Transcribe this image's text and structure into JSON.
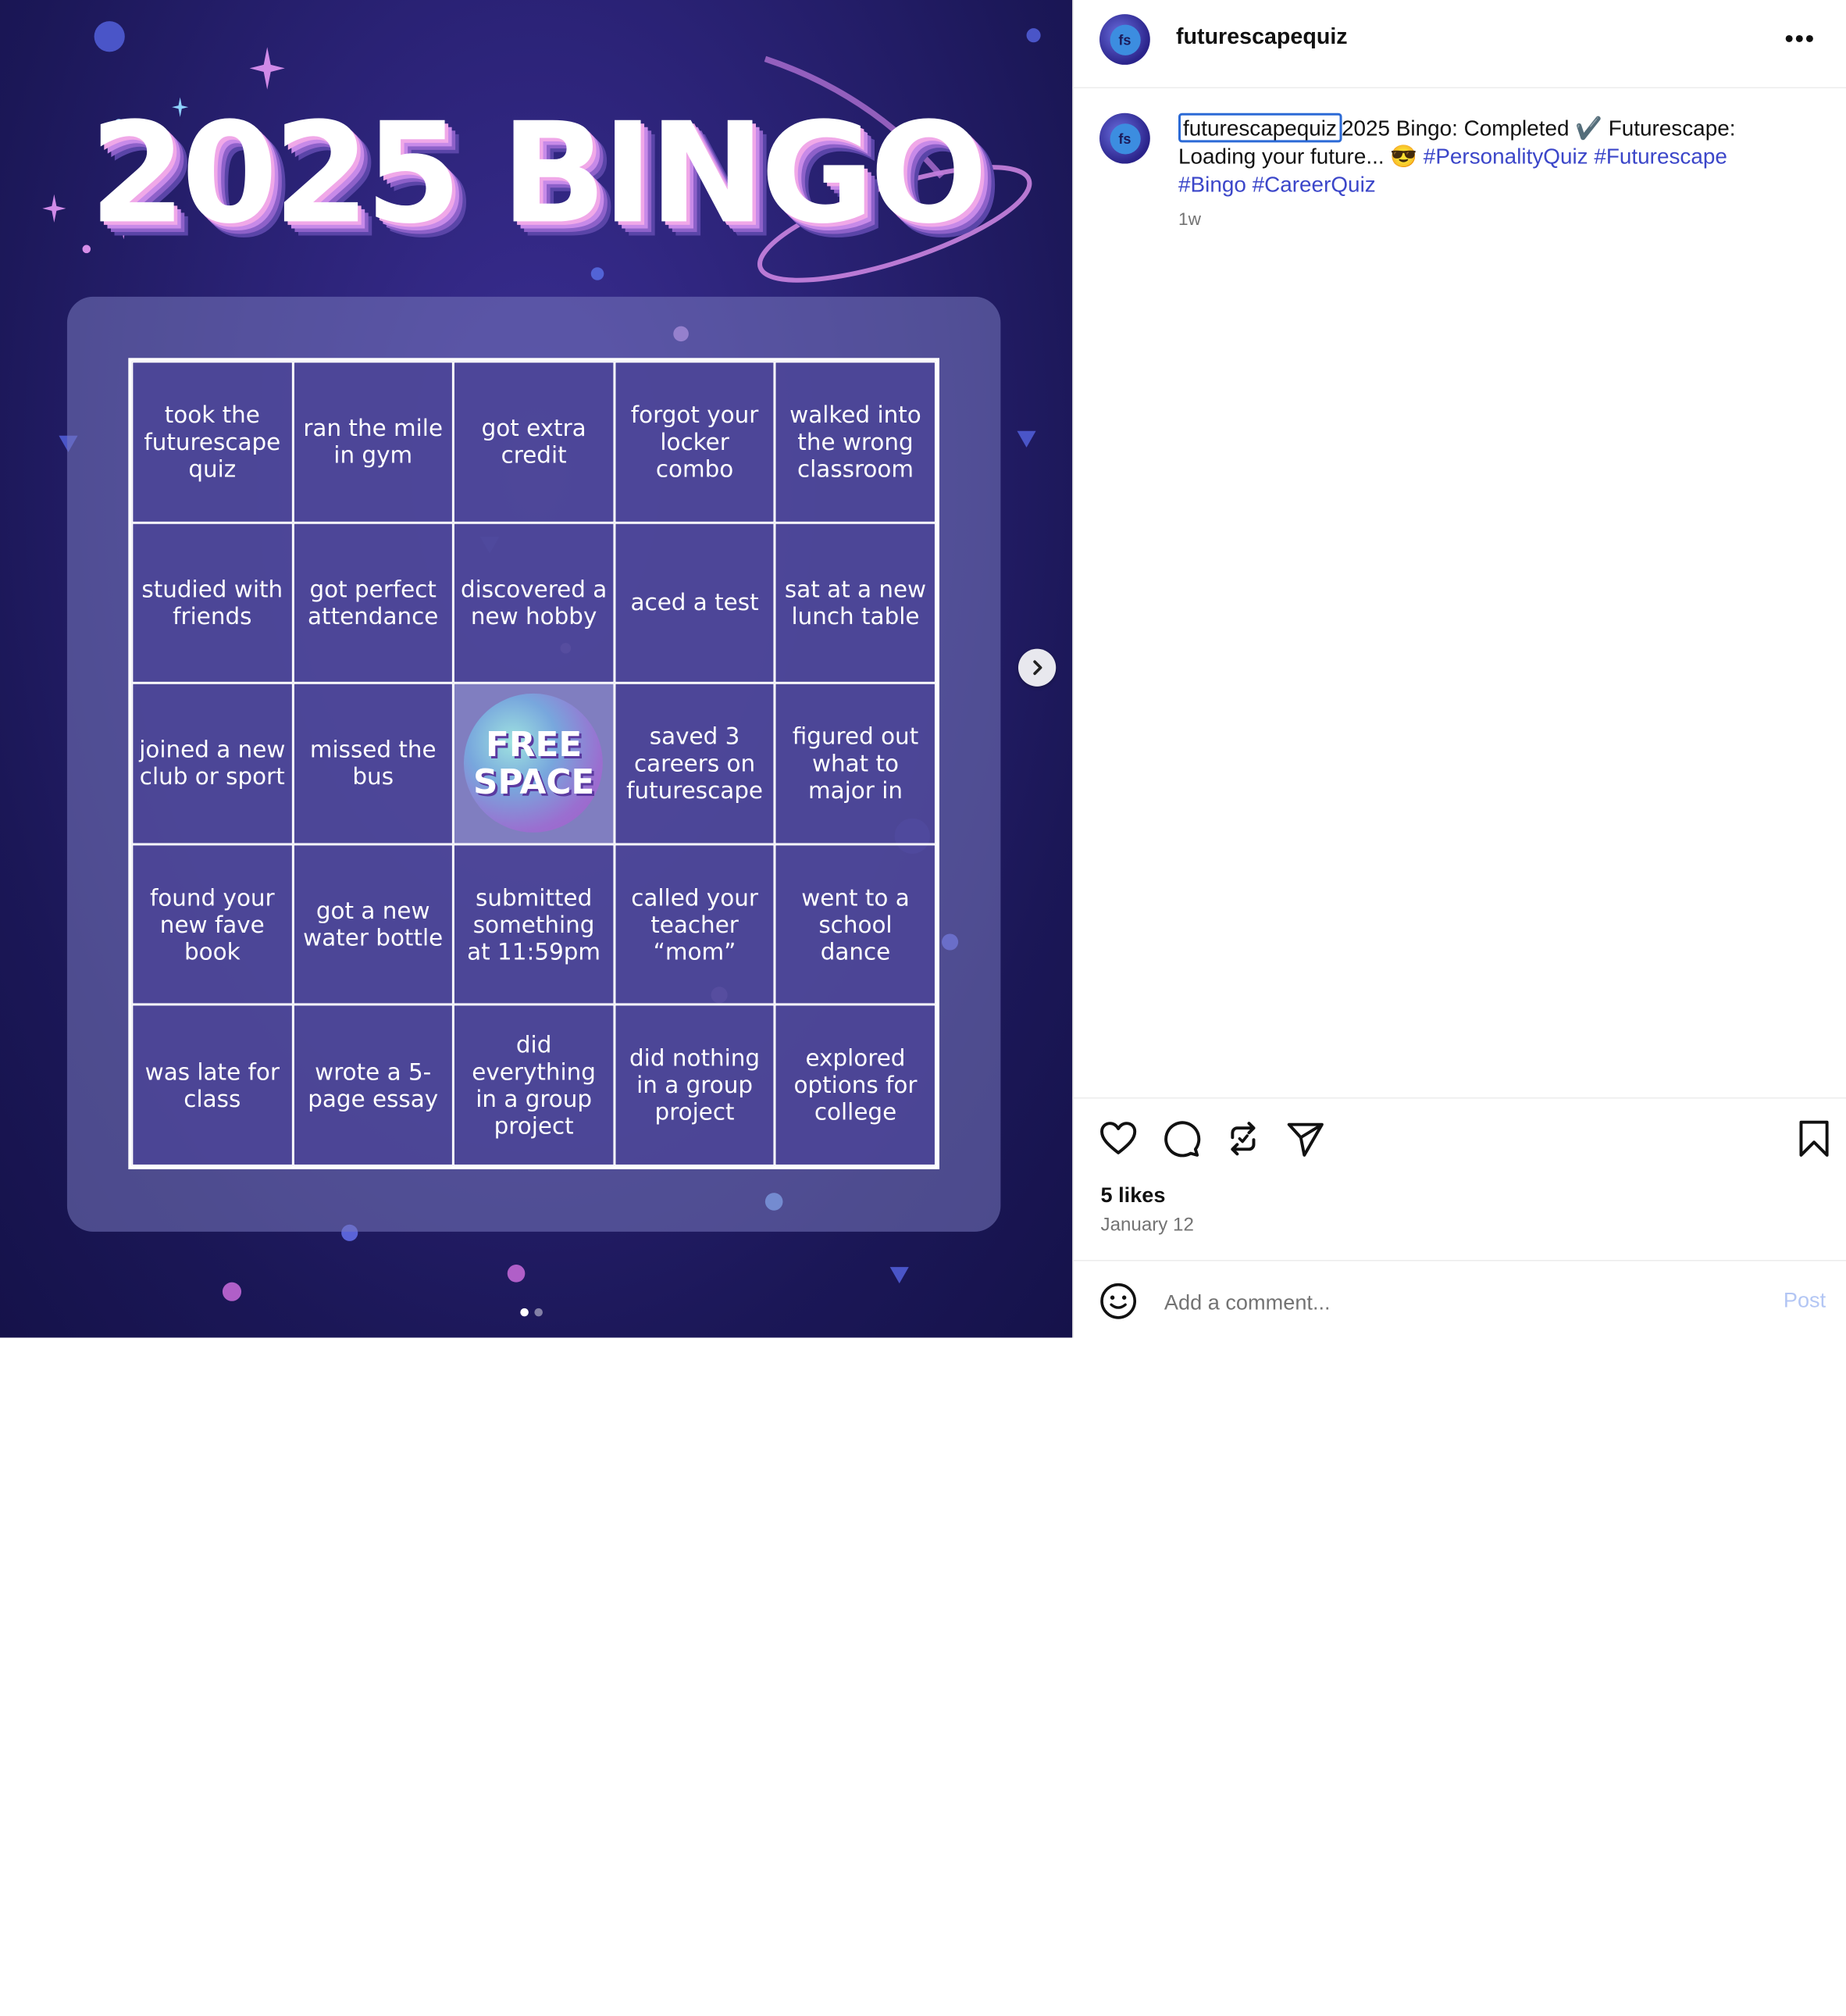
{
  "post": {
    "title": "2025 BINGO",
    "free_space": [
      "FREE",
      "SPACE"
    ],
    "cells": [
      "took the futurescape quiz",
      "ran the mile in gym",
      "got extra credit",
      "forgot your locker combo",
      "walked into the wrong classroom",
      "studied with friends",
      "got perfect attendance",
      "discovered a new hobby",
      "aced a test",
      "sat at a new lunch table",
      "joined a new club or sport",
      "missed the bus",
      "FREE SPACE",
      "saved 3 careers on futurescape",
      "figured out what to major in",
      "found your new fave book",
      "got a new water bottle",
      "submitted something at 11:59pm",
      "called your teacher “mom”",
      "went to a school dance",
      "was late for class",
      "wrote a 5-page essay",
      "did everything in a group project",
      "did nothing in a group project",
      "explored options for college"
    ],
    "carousel_pages": 2,
    "carousel_active": 1
  },
  "header": {
    "username": "futurescapequiz",
    "avatar_text": "fs",
    "more_label": "•••"
  },
  "caption": {
    "username": "futurescapequiz",
    "text": "2025 Bingo: Completed ✔️ Futurescape: Loading your future... 😎",
    "hashtags": [
      "#PersonalityQuiz",
      "#Futurescape",
      "#Bingo",
      "#CareerQuiz"
    ],
    "time_ago": "1w"
  },
  "engagement": {
    "likes": "5 likes",
    "date": "January 12"
  },
  "comment": {
    "placeholder": "Add a comment...",
    "post_label": "Post"
  },
  "icons": {
    "like": "heart-icon",
    "comment": "comment-bubble-icon",
    "repost": "repost-icon",
    "share": "send-icon",
    "save": "bookmark-icon",
    "emoji": "smiley-icon",
    "next": "chevron-right-icon"
  },
  "colors": {
    "accent_link": "#3b46c9",
    "focus_outline": "#2b6ad6",
    "post_button_disabled": "#b3c6f4",
    "image_background": "#2a2275"
  }
}
